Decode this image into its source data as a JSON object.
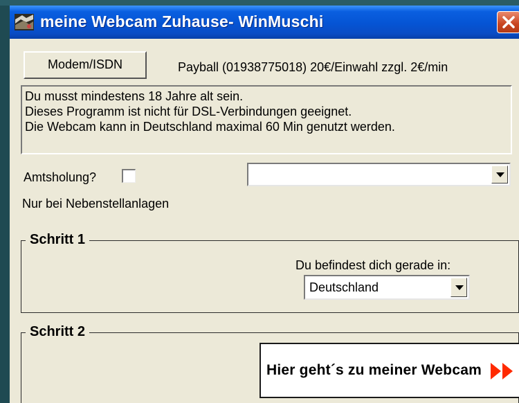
{
  "window": {
    "title": "meine Webcam Zuhause-  WinMuschi"
  },
  "icons": {
    "app": "app-icon",
    "close": "close-icon",
    "combo_arrow": "chevron-down-icon",
    "forward": "double-arrow-right-icon"
  },
  "colors": {
    "titlebar": "#0554d4",
    "close_button": "#c84420",
    "window_bg": "#ece9d8",
    "forward_arrows": "#ff2a00"
  },
  "connection": {
    "modem_button": "Modem/ISDN",
    "tariff": "Payball (01938775018) 20€/Einwahl zzgl. 2€/min"
  },
  "info": {
    "lines": [
      "Du musst mindestens 18 Jahre alt sein.",
      "Dieses Programm ist nicht für DSL-Verbindungen geeignet.",
      "Die Webcam kann in Deutschland maximal 60 Min genutzt werden."
    ]
  },
  "options": {
    "amtsholung_label": "Amtsholung?",
    "amtsholung_checked": false,
    "nebenstellen_label": "Nur bei Nebenstellanlagen",
    "top_select_value": ""
  },
  "step1": {
    "legend": "Schritt 1",
    "prompt": "Du befindest dich gerade in:",
    "country_value": "Deutschland"
  },
  "step2": {
    "legend": "Schritt 2",
    "button_label": "Hier geht´s zu meiner Webcam"
  }
}
